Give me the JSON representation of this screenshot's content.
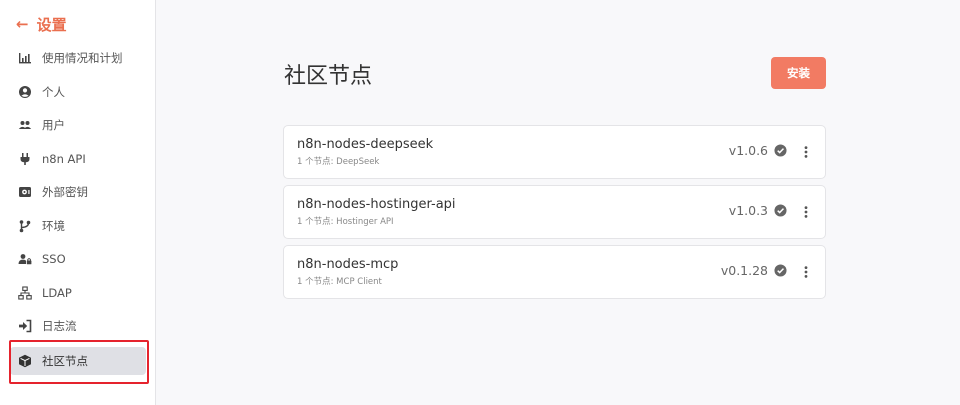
{
  "sidebar": {
    "back_label": "设置",
    "items": [
      {
        "label": "使用情况和计划",
        "icon": "bar-chart-icon",
        "active": false
      },
      {
        "label": "个人",
        "icon": "user-circle-icon",
        "active": false
      },
      {
        "label": "用户",
        "icon": "users-icon",
        "active": false
      },
      {
        "label": "n8n API",
        "icon": "plug-icon",
        "active": false
      },
      {
        "label": "外部密钥",
        "icon": "vault-icon",
        "active": false
      },
      {
        "label": "环境",
        "icon": "git-branch-icon",
        "active": false
      },
      {
        "label": "SSO",
        "icon": "user-lock-icon",
        "active": false
      },
      {
        "label": "LDAP",
        "icon": "network-icon",
        "active": false
      },
      {
        "label": "日志流",
        "icon": "sign-in-icon",
        "active": false
      },
      {
        "label": "社区节点",
        "icon": "cube-icon",
        "active": true
      }
    ]
  },
  "main": {
    "title": "社区节点",
    "install_label": "安装",
    "packages": [
      {
        "name": "n8n-nodes-deepseek",
        "nodes": "1 个节点: DeepSeek",
        "version": "v1.0.6"
      },
      {
        "name": "n8n-nodes-hostinger-api",
        "nodes": "1 个节点: Hostinger API",
        "version": "v1.0.3"
      },
      {
        "name": "n8n-nodes-mcp",
        "nodes": "1 个节点: MCP Client",
        "version": "v0.1.28"
      }
    ]
  },
  "colors": {
    "accent": "#ea6f4f",
    "button": "#f27b63",
    "active_bg": "#dfe0e5",
    "highlight": "#e5232d"
  }
}
